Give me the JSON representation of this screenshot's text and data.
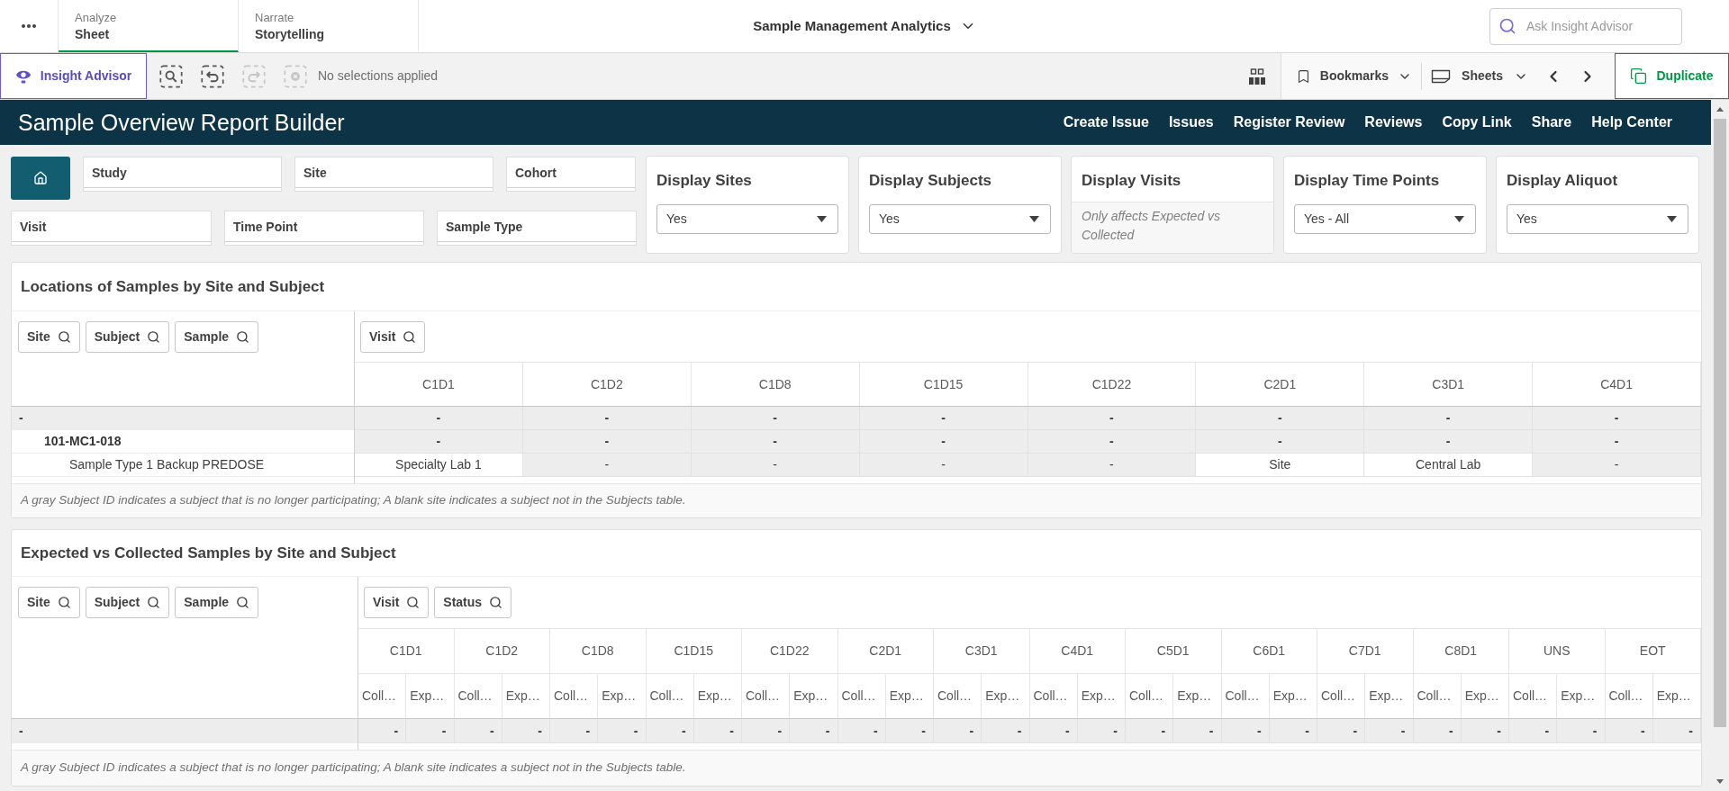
{
  "top_bar": {
    "tabs": [
      {
        "mode": "Analyze",
        "label": "Sheet",
        "selected": true
      },
      {
        "mode": "Narrate",
        "label": "Storytelling",
        "selected": false
      }
    ],
    "app_title": "Sample Management Analytics",
    "search": {
      "placeholder": "Ask Insight Advisor"
    }
  },
  "toolbar": {
    "insight_advisor": "Insight Advisor",
    "tools": [
      {
        "kind": "smart-search",
        "disabled": false
      },
      {
        "kind": "step-back",
        "disabled": false
      },
      {
        "kind": "step-forward",
        "disabled": true
      },
      {
        "kind": "clear-selections",
        "disabled": true
      }
    ],
    "selections": "No selections applied",
    "bookmarks": "Bookmarks",
    "sheets": "Sheets",
    "duplicate": "Duplicate"
  },
  "banner": {
    "title": "Sample Overview Report Builder",
    "links": [
      "Create Issue",
      "Issues",
      "Register Review",
      "Reviews",
      "Copy Link",
      "Share",
      "Help Center"
    ]
  },
  "filters": {
    "fields": [
      "Study",
      "Site",
      "Cohort",
      "Visit",
      "Time Point",
      "Sample Type"
    ]
  },
  "display_options": [
    {
      "title": "Display Sites",
      "kind": "dropdown",
      "value": "Yes"
    },
    {
      "title": "Display Subjects",
      "kind": "dropdown",
      "value": "Yes"
    },
    {
      "title": "Display Visits",
      "kind": "note",
      "text": "Only affects Expected vs Collected"
    },
    {
      "title": "Display Time Points",
      "kind": "dropdown",
      "value": "Yes - All"
    },
    {
      "title": "Display Aliquot",
      "kind": "dropdown",
      "value": "Yes"
    }
  ],
  "locations_table": {
    "title": "Locations of Samples by Site and Subject",
    "row_filters": [
      "Site",
      "Subject",
      "Sample"
    ],
    "column_filters": [
      "Visit"
    ],
    "columns": [
      "C1D1",
      "C1D2",
      "C1D8",
      "C1D15",
      "C1D22",
      "C2D1",
      "C3D1",
      "C4D1"
    ],
    "rows": [
      {
        "label": "-",
        "kind": "group",
        "cells": [
          {
            "text": "-",
            "empty": true
          },
          {
            "text": "-",
            "empty": true
          },
          {
            "text": "-",
            "empty": true
          },
          {
            "text": "-",
            "empty": true
          },
          {
            "text": "-",
            "empty": true
          },
          {
            "text": "-",
            "empty": true
          },
          {
            "text": "-",
            "empty": true
          },
          {
            "text": "-",
            "empty": true
          }
        ],
        "children": [
          {
            "label": "101-MC1-018",
            "kind": "group",
            "cells": [
              {
                "text": "-",
                "empty": true
              },
              {
                "text": "-",
                "empty": true
              },
              {
                "text": "-",
                "empty": true
              },
              {
                "text": "-",
                "empty": true
              },
              {
                "text": "-",
                "empty": true
              },
              {
                "text": "-",
                "empty": true
              },
              {
                "text": "-",
                "empty": true
              },
              {
                "text": "-",
                "empty": true
              }
            ],
            "children": [
              {
                "label": "Sample Type 1 Backup PREDOSE",
                "kind": "item",
                "cells": [
                  {
                    "text": "Specialty Lab 1",
                    "empty": false
                  },
                  {
                    "text": "-",
                    "empty": true
                  },
                  {
                    "text": "-",
                    "empty": true
                  },
                  {
                    "text": "-",
                    "empty": true
                  },
                  {
                    "text": "-",
                    "empty": true
                  },
                  {
                    "text": "Site",
                    "empty": false
                  },
                  {
                    "text": "Central Lab",
                    "empty": false
                  },
                  {
                    "text": "-",
                    "empty": true
                  }
                ]
              }
            ]
          }
        ]
      }
    ],
    "note": "A gray Subject ID indicates a subject that is no longer participating; A blank site indicates a subject not in the Subjects table."
  },
  "expected_collected_table": {
    "title": "Expected vs Collected Samples by Site and Subject",
    "row_filters": [
      "Site",
      "Subject",
      "Sample"
    ],
    "column_filters": [
      "Visit",
      "Status"
    ],
    "visit_headers": [
      "C1D1",
      "C1D2",
      "C1D8",
      "C1D15",
      "C1D22",
      "C2D1",
      "C3D1",
      "C4D1",
      "C5D1",
      "C6D1",
      "C7D1",
      "C8D1",
      "UNS",
      "EOT"
    ],
    "columns": [
      "Coll…",
      "Exp…",
      "Coll…",
      "Exp…",
      "Coll…",
      "Exp…",
      "Coll…",
      "Exp…",
      "Coll…",
      "Exp…",
      "Coll…",
      "Exp…",
      "Coll…",
      "Exp…",
      "Coll…",
      "Exp…",
      "Coll…",
      "Exp…",
      "Coll…",
      "Exp…",
      "Coll…",
      "Exp…",
      "Coll…",
      "Exp…",
      "Coll…",
      "Exp…",
      "Coll…",
      "Exp…"
    ],
    "rows": [
      {
        "label": "-",
        "kind": "group",
        "cells": [
          {
            "text": "-",
            "empty": true
          },
          {
            "text": "-",
            "empty": true
          },
          {
            "text": "-",
            "empty": true
          },
          {
            "text": "-",
            "empty": true
          },
          {
            "text": "-",
            "empty": true
          },
          {
            "text": "-",
            "empty": true
          },
          {
            "text": "-",
            "empty": true
          },
          {
            "text": "-",
            "empty": true
          },
          {
            "text": "-",
            "empty": true
          },
          {
            "text": "-",
            "empty": true
          },
          {
            "text": "-",
            "empty": true
          },
          {
            "text": "-",
            "empty": true
          },
          {
            "text": "-",
            "empty": true
          },
          {
            "text": "-",
            "empty": true
          },
          {
            "text": "-",
            "empty": true
          },
          {
            "text": "-",
            "empty": true
          },
          {
            "text": "-",
            "empty": true
          },
          {
            "text": "-",
            "empty": true
          },
          {
            "text": "-",
            "empty": true
          },
          {
            "text": "-",
            "empty": true
          },
          {
            "text": "-",
            "empty": true
          },
          {
            "text": "-",
            "empty": true
          },
          {
            "text": "-",
            "empty": true
          },
          {
            "text": "-",
            "empty": true
          },
          {
            "text": "-",
            "empty": true
          },
          {
            "text": "-",
            "empty": true
          },
          {
            "text": "-",
            "empty": true
          },
          {
            "text": "-",
            "empty": true
          }
        ]
      }
    ],
    "note": "A gray Subject ID indicates a subject that is no longer participating; A blank site indicates a subject not in the Subjects table."
  }
}
